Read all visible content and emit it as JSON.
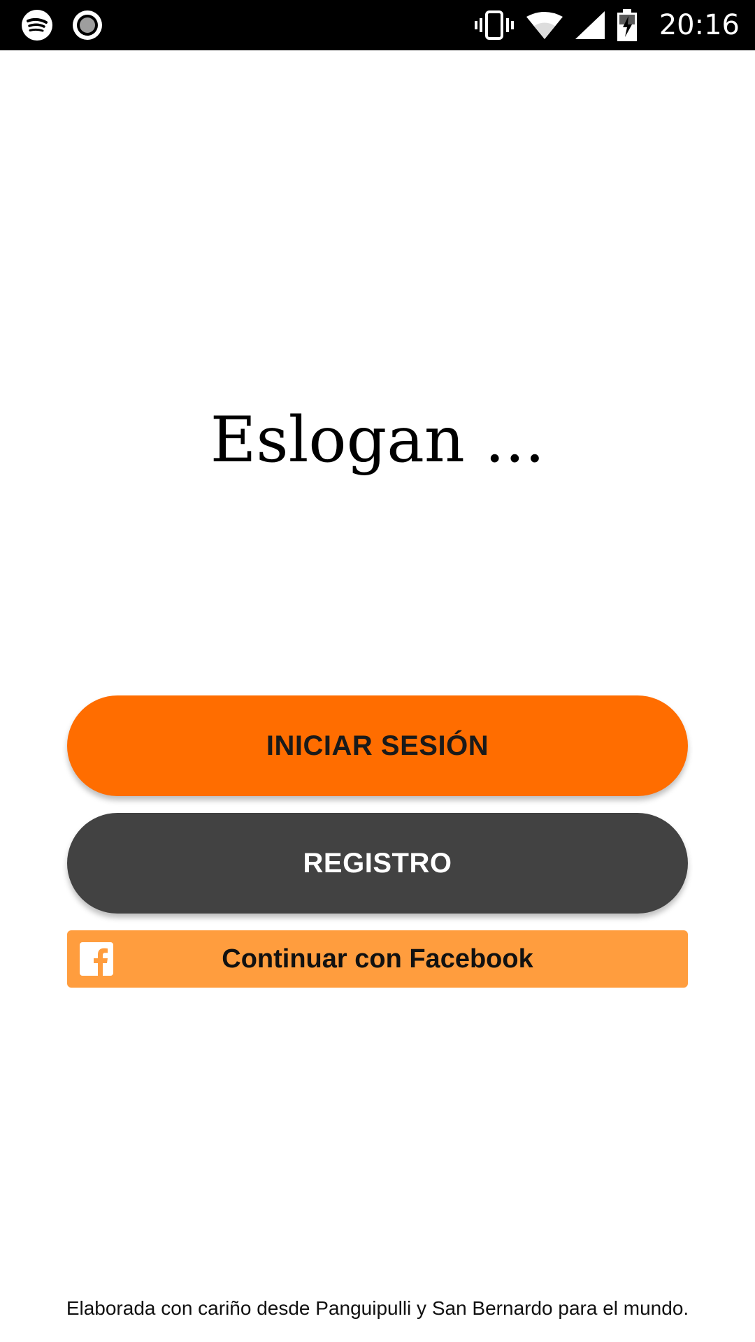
{
  "status_bar": {
    "time": "20:16",
    "left_icons": [
      "spotify-icon",
      "record-icon"
    ],
    "right_icons": [
      "vibrate-icon",
      "wifi-icon",
      "signal-icon",
      "battery-charging-icon"
    ]
  },
  "main": {
    "slogan": "Eslogan ..."
  },
  "buttons": {
    "login_label": "INICIAR SESIÓN",
    "register_label": "REGISTRO",
    "facebook_label": "Continuar con Facebook"
  },
  "footer": {
    "text": "Elaborada con cariño desde Panguipulli y San Bernardo para el mundo."
  },
  "colors": {
    "accent": "#ff6d00",
    "secondary": "#424242",
    "facebook_button": "#ff9d3e",
    "status_bar": "#000000"
  }
}
